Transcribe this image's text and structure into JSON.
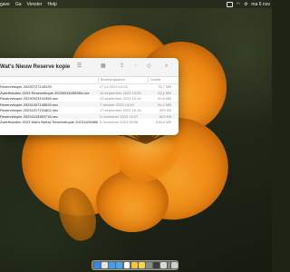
{
  "menubar": {
    "items": [
      "gave",
      "Ga",
      "Venster",
      "Help"
    ],
    "clock": "ma 6 nov"
  },
  "finder": {
    "title": "Wat's Nieuw Reserve kopie",
    "columns": {
      "name": "",
      "date": "Bewerkingsdatum",
      "size": "Grootte"
    },
    "rows": [
      {
        "name": "Reservekopie 20230727140225",
        "date": "27 jul 2023 16:02",
        "size": "76,7 MB"
      },
      {
        "name": "Zwerfhanden 2023 Reservekopie 20230916155954.rwv",
        "date": "16 september 2023 15:59",
        "size": "83,1 MB"
      },
      {
        "name": "Reservekopie 20230923141956.rwv",
        "date": "23 september 2023 15:16",
        "size": "83,6 MB"
      },
      {
        "name": "Reservekopie 20231007145026.rwv",
        "date": "7 oktober 2023 14:50",
        "size": "54,2 MB"
      },
      {
        "name": "Reservekopie 20231017151802.rwv",
        "date": "17 september 2023 15:18",
        "size": "403 KB"
      },
      {
        "name": "Reservekopie 20231103150715.rwv",
        "date": "3 november 2023 15:07",
        "size": "603 KB"
      },
      {
        "name": "Zwerfhanden 2023 Wat's Nieuw Reservekopie 20231105085802.rwv",
        "date": "5 november 2023 08:58",
        "size": "218,6 MB"
      }
    ]
  },
  "dock": {
    "apps": [
      {
        "name": "finder-icon",
        "color": "#2f86f4"
      },
      {
        "name": "launchpad-icon",
        "color": "#e6e6e6"
      },
      {
        "name": "safari-icon",
        "color": "#3aa0f0"
      },
      {
        "name": "mail-icon",
        "color": "#4aa5ef"
      },
      {
        "name": "calendar-icon",
        "color": "#ffffff"
      },
      {
        "name": "photos-icon",
        "color": "#f2c440"
      },
      {
        "name": "notes-icon",
        "color": "#f6d54a"
      },
      {
        "name": "settings-icon",
        "color": "#8a8a8a"
      },
      {
        "name": "app-icon",
        "color": "#3c3c3c"
      },
      {
        "name": "app-icon",
        "color": "#d9d9d9"
      }
    ],
    "trash": {
      "name": "trash-icon",
      "color": "#cfcfcf"
    }
  },
  "accent": "#f08a12"
}
